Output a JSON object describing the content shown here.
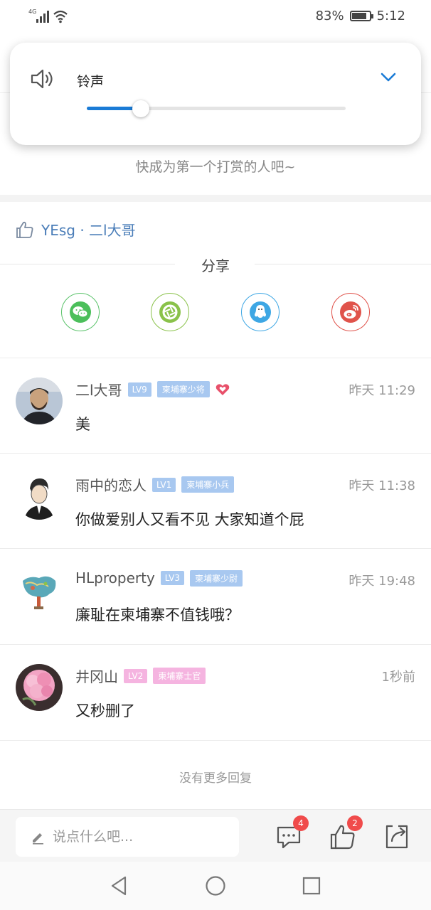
{
  "status_bar": {
    "network": "4G",
    "battery": "83%",
    "time": "5:12"
  },
  "volume_popup": {
    "label": "铃声",
    "level": 0.21
  },
  "reward_hint": "快成为第一个打赏的人吧~",
  "likes": {
    "names": "YEsg · 二l大哥"
  },
  "share": {
    "title": "分享",
    "targets": [
      "wechat-icon",
      "moments-icon",
      "qq-icon",
      "weibo-icon"
    ]
  },
  "comments": [
    {
      "name": "二l大哥",
      "level": "LV9",
      "title": "柬埔寨少将",
      "time": "昨天 11:29",
      "text": "美",
      "badge_color": "#a8c8f0"
    },
    {
      "name": "雨中的恋人",
      "level": "LV1",
      "title": "柬埔寨小兵",
      "time": "昨天 11:38",
      "text": "你做爱别人又看不见  大家知道个屁",
      "badge_color": "#a8c8f0"
    },
    {
      "name": "HLproperty",
      "level": "LV3",
      "title": "柬埔寨少尉",
      "time": "昨天 19:48",
      "text": "廉耻在柬埔寨不值钱哦？",
      "badge_color": "#a8c8f0"
    },
    {
      "name": "井冈山",
      "level": "LV2",
      "title": "柬埔寨士官",
      "time": "1秒前",
      "text": "又秒删了",
      "badge_color": "#f5b4e0"
    }
  ],
  "no_more": "没有更多回复",
  "bottom_bar": {
    "input_placeholder": "说点什么吧...",
    "comment_count": "4",
    "like_count": "2"
  },
  "colors": {
    "accent": "#1a7bd6",
    "link": "#4a7db8",
    "badge_red": "#f04b4b"
  }
}
